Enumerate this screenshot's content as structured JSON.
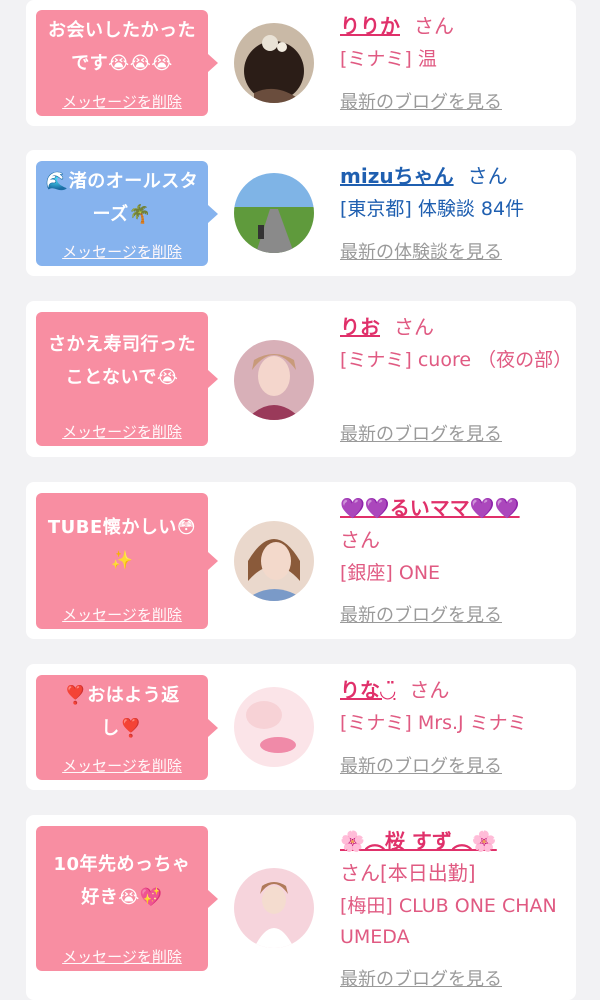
{
  "cards": [
    {
      "bubble_lines": [
        "お会いしたかった",
        "です😭😭😭"
      ],
      "delete_label": "メッセージを削除",
      "name": "りりか",
      "san": "さん",
      "detail": "[ミナミ] 温",
      "link": "最新のブログを見る",
      "avatar_icon": "avatar-photo-hair-icon"
    },
    {
      "bubble_lines": [
        "🌊渚のオールスタ",
        "ーズ🌴"
      ],
      "delete_label": "メッセージを削除",
      "name": "mizuちゃん",
      "san": "さん",
      "detail": "[東京都] 体験談 84件",
      "link": "最新の体験談を見る",
      "avatar_icon": "avatar-photo-road-icon"
    },
    {
      "bubble_lines": [
        "さかえ寿司行った",
        "ことないで😭"
      ],
      "delete_label": "メッセージを削除",
      "name": "りお",
      "san": "さん",
      "detail": "[ミナミ] cuore （夜の部）",
      "link": "最新のブログを見る",
      "avatar_icon": "avatar-photo-woman-icon"
    },
    {
      "bubble_lines": [
        "TUBE懐かしい😳",
        "✨"
      ],
      "delete_label": "メッセージを削除",
      "name": "💜💜るいママ💜💜",
      "san": "さん",
      "detail": "[銀座] ONE",
      "link": "最新のブログを見る",
      "avatar_icon": "avatar-photo-woman-icon"
    },
    {
      "bubble_lines": [
        "❣️おはよう返",
        "し❣️"
      ],
      "delete_label": "メッセージを削除",
      "name": "りな◡̈",
      "san": "さん",
      "detail": "[ミナミ] Mrs.J ミナミ",
      "link": "最新のブログを見る",
      "avatar_icon": "avatar-photo-lips-icon"
    },
    {
      "bubble_lines": [
        "10年先めっちゃ",
        "好き😭💖"
      ],
      "delete_label": "メッセージを削除",
      "name": "🌸︵桜 すず︵🌸",
      "san": "さん[本日出勤]",
      "detail": "[梅田] CLUB ONE CHAN UMEDA",
      "link": "最新のブログを見る",
      "avatar_icon": "avatar-photo-woman-icon"
    }
  ],
  "colors": {
    "bubble_pink": "#f88ea2",
    "bubble_blue": "#86b3ee",
    "name_pink": "#e0306a",
    "name_blue": "#1f5fb0",
    "link_gray": "#9a9a9a"
  }
}
